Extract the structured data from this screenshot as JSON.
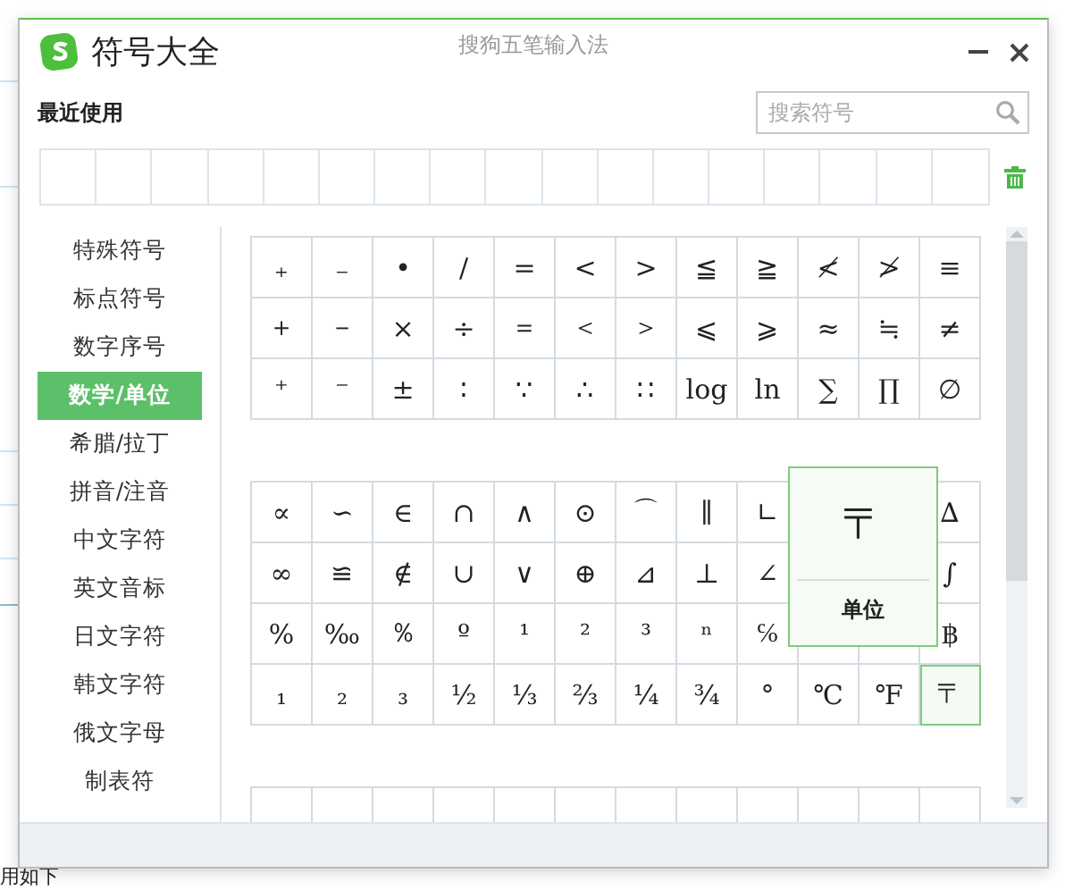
{
  "window": {
    "title": "符号大全",
    "subtitle": "搜狗五笔输入法"
  },
  "recent": {
    "label": "最近使用"
  },
  "search": {
    "placeholder": "搜索符号"
  },
  "sidebar": {
    "items": [
      {
        "label": "特殊符号",
        "selected": false
      },
      {
        "label": "标点符号",
        "selected": false
      },
      {
        "label": "数字序号",
        "selected": false
      },
      {
        "label": "数学/单位",
        "selected": true
      },
      {
        "label": "希腊/拉丁",
        "selected": false
      },
      {
        "label": "拼音/注音",
        "selected": false
      },
      {
        "label": "中文字符",
        "selected": false
      },
      {
        "label": "英文音标",
        "selected": false
      },
      {
        "label": "日文字符",
        "selected": false
      },
      {
        "label": "韩文字符",
        "selected": false
      },
      {
        "label": "俄文字母",
        "selected": false
      },
      {
        "label": "制表符",
        "selected": false
      }
    ]
  },
  "groups": [
    {
      "rows": [
        [
          {
            "symbol": "₊",
            "selected": false
          },
          {
            "symbol": "₋",
            "selected": false
          },
          {
            "symbol": "•",
            "selected": false
          },
          {
            "symbol": "/",
            "selected": false
          },
          {
            "symbol": "=",
            "selected": false
          },
          {
            "symbol": "<",
            "selected": false
          },
          {
            "symbol": ">",
            "selected": false
          },
          {
            "symbol": "≦",
            "selected": false
          },
          {
            "symbol": "≧",
            "selected": false
          },
          {
            "symbol": "≮",
            "selected": false
          },
          {
            "symbol": "≯",
            "selected": false
          },
          {
            "symbol": "≡",
            "selected": false
          }
        ],
        [
          {
            "symbol": "＋",
            "selected": false
          },
          {
            "symbol": "－",
            "selected": false
          },
          {
            "symbol": "×",
            "selected": false
          },
          {
            "symbol": "÷",
            "selected": false
          },
          {
            "symbol": "＝",
            "selected": false
          },
          {
            "symbol": "＜",
            "selected": false
          },
          {
            "symbol": "＞",
            "selected": false
          },
          {
            "symbol": "⩽",
            "selected": false
          },
          {
            "symbol": "⩾",
            "selected": false
          },
          {
            "symbol": "≈",
            "selected": false
          },
          {
            "symbol": "≒",
            "selected": false
          },
          {
            "symbol": "≠",
            "selected": false
          }
        ],
        [
          {
            "symbol": "⁺",
            "selected": false
          },
          {
            "symbol": "⁻",
            "selected": false
          },
          {
            "symbol": "±",
            "selected": false
          },
          {
            "symbol": "∶",
            "selected": false
          },
          {
            "symbol": "∵",
            "selected": false
          },
          {
            "symbol": "∴",
            "selected": false
          },
          {
            "symbol": "∷",
            "selected": false
          },
          {
            "symbol": "log",
            "selected": false
          },
          {
            "symbol": "ln",
            "selected": false
          },
          {
            "symbol": "∑",
            "selected": false
          },
          {
            "symbol": "∏",
            "selected": false
          },
          {
            "symbol": "∅",
            "selected": false
          }
        ]
      ]
    },
    {
      "rows": [
        [
          {
            "symbol": "∝",
            "selected": false
          },
          {
            "symbol": "∽",
            "selected": false
          },
          {
            "symbol": "∈",
            "selected": false
          },
          {
            "symbol": "∩",
            "selected": false
          },
          {
            "symbol": "∧",
            "selected": false
          },
          {
            "symbol": "⊙",
            "selected": false
          },
          {
            "symbol": "⌒",
            "selected": false
          },
          {
            "symbol": "∥",
            "selected": false
          },
          {
            "symbol": "∟",
            "selected": false
          },
          {},
          {},
          {
            "symbol": "∆",
            "selected": false
          }
        ],
        [
          {
            "symbol": "∞",
            "selected": false
          },
          {
            "symbol": "≌",
            "selected": false
          },
          {
            "symbol": "∉",
            "selected": false
          },
          {
            "symbol": "∪",
            "selected": false
          },
          {
            "symbol": "∨",
            "selected": false
          },
          {
            "symbol": "⊕",
            "selected": false
          },
          {
            "symbol": "⊿",
            "selected": false
          },
          {
            "symbol": "⊥",
            "selected": false
          },
          {
            "symbol": "∠",
            "selected": false
          },
          {},
          {},
          {
            "symbol": "∫",
            "selected": false
          }
        ],
        [
          {
            "symbol": "%",
            "selected": false
          },
          {
            "symbol": "‰",
            "selected": false
          },
          {
            "symbol": "％",
            "selected": false
          },
          {
            "symbol": "º",
            "selected": false
          },
          {
            "symbol": "¹",
            "selected": false
          },
          {
            "symbol": "²",
            "selected": false
          },
          {
            "symbol": "³",
            "selected": false
          },
          {
            "symbol": "ⁿ",
            "selected": false
          },
          {
            "symbol": "℅",
            "selected": false
          },
          {
            "selected": false
          },
          {
            "selected": false
          },
          {
            "symbol": "฿",
            "selected": false
          }
        ],
        [
          {
            "symbol": "₁",
            "selected": false
          },
          {
            "symbol": "₂",
            "selected": false
          },
          {
            "symbol": "₃",
            "selected": false
          },
          {
            "symbol": "½",
            "selected": false
          },
          {
            "symbol": "⅓",
            "selected": false
          },
          {
            "symbol": "⅔",
            "selected": false
          },
          {
            "symbol": "¼",
            "selected": false
          },
          {
            "symbol": "¾",
            "selected": false
          },
          {
            "symbol": "°",
            "selected": false
          },
          {
            "symbol": "℃",
            "selected": false
          },
          {
            "symbol": "℉",
            "selected": false
          },
          {
            "symbol": "〒",
            "selected": true
          }
        ]
      ]
    }
  ],
  "preview": {
    "symbol": "〒",
    "category": "单位"
  },
  "background_text": "用如下"
}
